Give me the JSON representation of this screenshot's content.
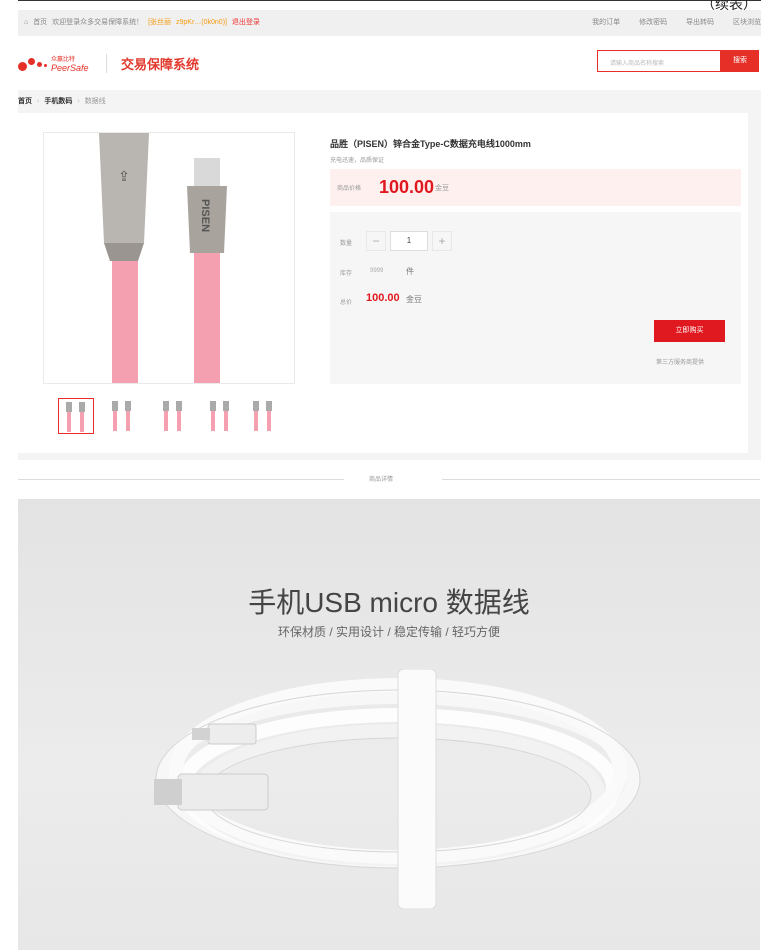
{
  "corner_text": "（续表）",
  "topbar": {
    "home": "首页",
    "welcome": "欢迎登录众多交易保障系统！",
    "account_badge": "[张丝丽",
    "account_id": "z9pKr…(0k0n0)]",
    "logout": "退出登录",
    "links": [
      "我的订单",
      "修改密码",
      "导出转码",
      "区块浏览"
    ]
  },
  "header": {
    "brand_cn": "众赢比特",
    "brand_en": "PeerSafe",
    "system_name": "交易保障系统",
    "search_placeholder": "请输入商品名称搜索",
    "search_button": "搜索"
  },
  "breadcrumb": [
    "首页",
    "手机数码",
    "数据线"
  ],
  "product": {
    "title": "品胜（PISEN）锌合金Type-C数据充电线1000mm",
    "subtitle": "充电迅速，品质保证",
    "price_label": "商品价格",
    "price": "100.00",
    "price_unit": "金豆",
    "qty_label": "数量",
    "qty": "1",
    "stock_label": "库存",
    "stock": "9999",
    "stock_unit": "件",
    "total_label": "总价",
    "total": "100.00",
    "total_unit": "金豆",
    "buy_button": "立即购买",
    "third_party": "第三方服务商提供",
    "minus": "−",
    "plus": "+",
    "plug_brand": "PISEN"
  },
  "section_label": "商品详情",
  "description": {
    "title": "手机USB micro 数据线",
    "subtitle": "环保材质 / 实用设计 / 稳定传输 / 轻巧方便"
  },
  "colors": {
    "accent": "#e63027",
    "price": "#e0181f",
    "cable_pink": "#f4a0b1"
  }
}
